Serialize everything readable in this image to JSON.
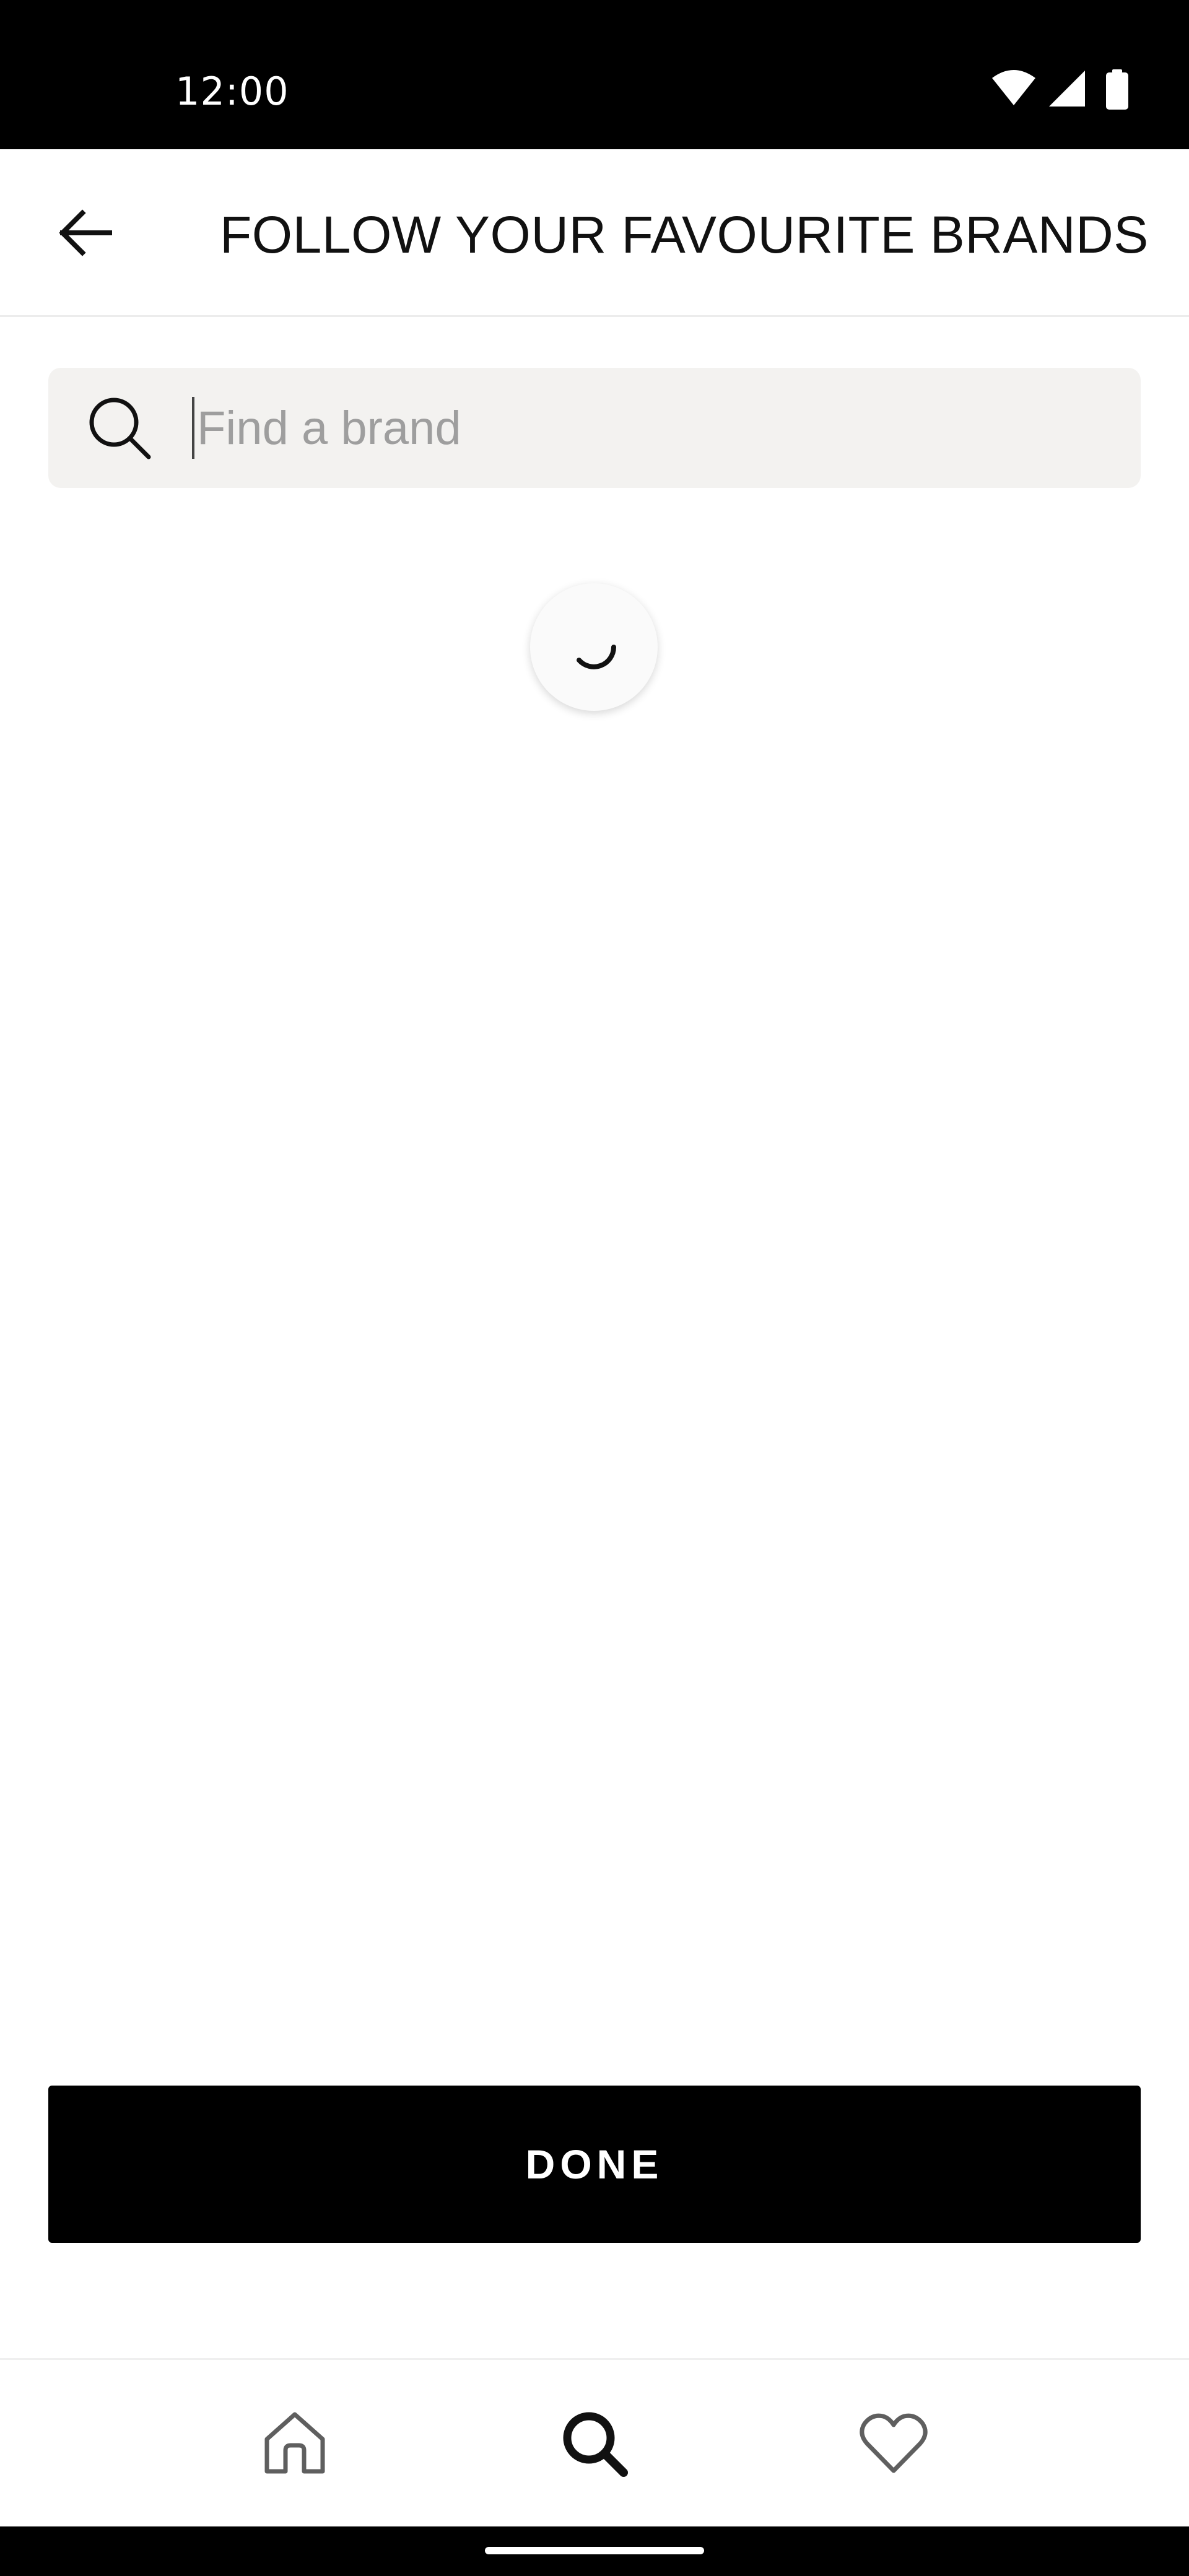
{
  "status_bar": {
    "time": "12:00",
    "icons": [
      "wifi-icon",
      "cellular-signal-icon",
      "battery-icon"
    ]
  },
  "header": {
    "title": "FOLLOW YOUR FAVOURITE BRANDS",
    "back_icon": "arrow-left-icon"
  },
  "search": {
    "placeholder": "Find a brand",
    "value": "",
    "icon": "search-icon"
  },
  "loading": {
    "visible": true,
    "icon": "loading-spinner-icon"
  },
  "actions": {
    "done_label": "DONE"
  },
  "bottom_nav": {
    "items": [
      {
        "name": "home",
        "icon": "home-icon",
        "active": false
      },
      {
        "name": "search",
        "icon": "search-icon",
        "active": true
      },
      {
        "name": "saved",
        "icon": "heart-icon",
        "active": false
      }
    ]
  },
  "colors": {
    "background": "#ffffff",
    "status_bar": "#000000",
    "search_field_bg": "#f3f2f0",
    "primary_button": "#000000",
    "primary_button_text": "#ffffff",
    "placeholder_text": "#9e9e9e",
    "inactive_icon": "#5f5f5f",
    "active_icon": "#111111"
  }
}
